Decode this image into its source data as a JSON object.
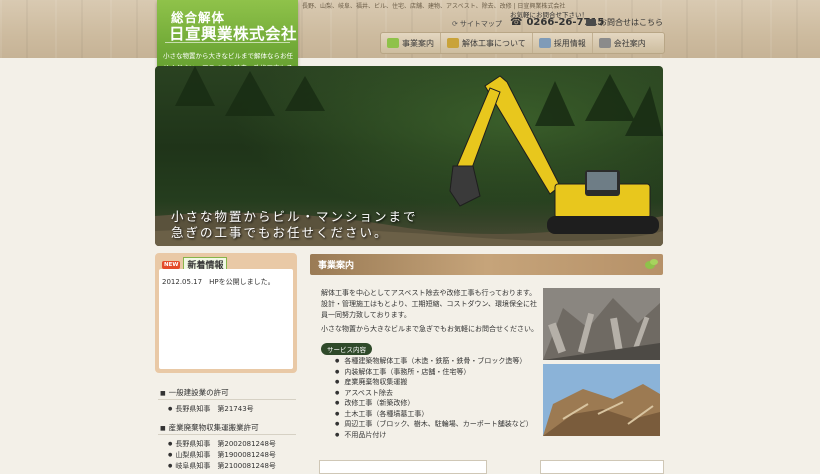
{
  "header": {
    "logo_top": "総合解体",
    "logo_name": "日宣興業株式会社",
    "logo_desc": "小さな物置から大きなビルまで解体ならお任せください。アスベスト除去、改修工事も承ります。",
    "tagline": "長野、山梨、岐阜、福井、ビル、住宅、店舗、建物、アスベスト、除去、改修 | 日宣興業株式会社",
    "sitemap_label": "サイトマップ",
    "contact_caption": "お気軽にお問合せ下さい！",
    "phone": "0266-26-7715",
    "inquiry_label": "お問合せはこちら"
  },
  "nav": [
    {
      "label": "事業案内",
      "icon": "grid-icon",
      "color": "#8fc24a"
    },
    {
      "label": "解体工事について",
      "icon": "building-icon",
      "color": "#c9a33a"
    },
    {
      "label": "採用情報",
      "icon": "document-icon",
      "color": "#7f9bb8"
    },
    {
      "label": "会社案内",
      "icon": "company-icon",
      "color": "#8b8b8b"
    }
  ],
  "hero": {
    "line1": "小さな物置からビル・マンションまで",
    "line2": "急ぎの工事でもお任せください。"
  },
  "news": {
    "badge": "NEW",
    "title": "新着情報",
    "items": [
      {
        "text": "2012.05.17　HPを公開しました。"
      }
    ]
  },
  "licenses": [
    {
      "title": "一般建設業の許可",
      "items": [
        "長野県知事　第21743号"
      ]
    },
    {
      "title": "産業廃棄物収集運搬業許可",
      "items": [
        "長野県知事　第2002081248号",
        "山梨県知事　第1900081248号",
        "岐阜県知事　第2100081248号"
      ]
    }
  ],
  "main": {
    "section_title": "事業案内",
    "paragraph1": "解体工事を中心としてアスベスト除去や改修工事も行っております。設計・管理施工はもとより、工期短縮、コストダウン、環境保全に社員一同努力致しております。",
    "paragraph2": "小さな物置から大きなビルまで急ぎでもお気軽にお問合せください。",
    "services_label": "サービス内容",
    "services": [
      "各種建築物解体工事（木造・鉄筋・鉄骨・ブロック造等）",
      "内装解体工事（事務所・店舗・住宅等）",
      "産業廃棄物収集運搬",
      "アスベスト除去",
      "改修工事（新築改修）",
      "土木工事（各種墳墓工事）",
      "周辺工事（ブロック、樹木、駐輪場、カーポート舗装など）",
      "不用品片付け"
    ]
  },
  "colors": {
    "accent_green": "#6fa836",
    "section_brown": "#b69168",
    "news_frame": "#e9c9a6"
  }
}
